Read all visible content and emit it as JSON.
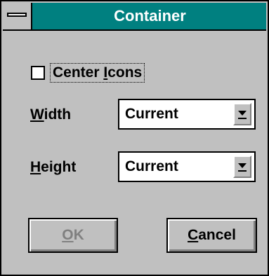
{
  "window": {
    "title": "Container"
  },
  "checkbox": {
    "label_prefix": "Center ",
    "label_mnemonic": "I",
    "label_rest": "cons",
    "checked": false
  },
  "width_field": {
    "label_mnemonic": "W",
    "label_rest": "idth",
    "value": "Current"
  },
  "height_field": {
    "label_mnemonic": "H",
    "label_rest": "eight",
    "value": "Current"
  },
  "buttons": {
    "ok_mnemonic": "O",
    "ok_rest": "K",
    "ok_enabled": false,
    "cancel_mnemonic": "C",
    "cancel_rest": "ancel"
  },
  "colors": {
    "title_bar": "#008080",
    "face": "#c0c0c0",
    "disabled_text": "#808080"
  },
  "icons": [
    "system-menu-icon",
    "dropdown-arrow-icon"
  ]
}
